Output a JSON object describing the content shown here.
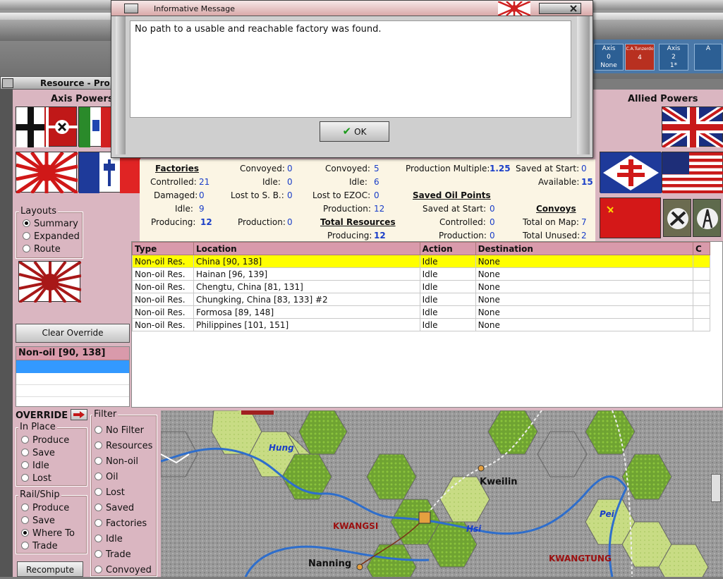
{
  "modal": {
    "title": "Informative Message",
    "message": "No path to a usable and reachable factory was found.",
    "ok_label": "OK"
  },
  "window": {
    "title": "Resource - Pro"
  },
  "counters": [
    {
      "top": "Axis",
      "bottom": "0",
      "sub": "None"
    },
    {
      "top": "C.A.Tunzerdo",
      "bottom": "4",
      "sub": ""
    },
    {
      "top": "Axis",
      "bottom": "2",
      "sub": "1*"
    },
    {
      "top": "A",
      "bottom": "",
      "sub": ""
    }
  ],
  "axis_header": "Axis Powers",
  "allied_header": "Allied Powers",
  "layouts": {
    "label": "Layouts",
    "options": [
      "Summary",
      "Expanded",
      "Route"
    ],
    "selected": "Summary"
  },
  "clear_override_label": "Clear Override",
  "selected_list": {
    "header": "Non-oil [90, 138]"
  },
  "stats": {
    "factories_header": "Factories",
    "controlled_label": "Controlled:",
    "controlled_val": "21",
    "damaged_label": "Damaged:",
    "damaged_val": "0",
    "idle_label": "Idle:",
    "idle_val": "9",
    "producing_label": "Producing:",
    "producing_val": "12",
    "c2_convoyed_label": "Convoyed:",
    "c2_convoyed_val": "0",
    "c2_idle_label": "Idle:",
    "c2_idle_val": "0",
    "c2_lost_label": "Lost to S. B.:",
    "c2_lost_val": "0",
    "c2_production_label": "Production:",
    "c2_production_val": "0",
    "c3_convoyed_label": "Convoyed:",
    "c3_convoyed_val": "5",
    "c3_idle_label": "Idle:",
    "c3_idle_val": "6",
    "c3_lost_label": "Lost to EZOC:",
    "c3_lost_val": "0",
    "c3_production_label": "Production:",
    "c3_production_val": "12",
    "total_resources_header": "Total Resources",
    "c3_producing_label": "Producing:",
    "c3_producing_val": "12",
    "prod_mult_label": "Production Multiple:",
    "prod_mult_val": "1.25",
    "saved_oil_header": "Saved Oil Points",
    "oil_saved_label": "Saved at Start:",
    "oil_saved_val": "0",
    "oil_controlled_label": "Controlled:",
    "oil_controlled_val": "0",
    "oil_production_label": "Production:",
    "oil_production_val": "0",
    "c5_saved_label": "Saved at Start:",
    "c5_saved_val": "0",
    "c5_available_label": "Available:",
    "c5_available_val": "15",
    "convoys_header": "Convoys",
    "conv_total_map_label": "Total on Map:",
    "conv_total_map_val": "7",
    "conv_total_unused_label": "Total Unused:",
    "conv_total_unused_val": "2"
  },
  "grid": {
    "columns": [
      "Type",
      "Location",
      "Action",
      "Destination",
      "C"
    ],
    "rows": [
      [
        "Non-oil Res.",
        "China [90, 138]",
        "Idle",
        "None",
        ""
      ],
      [
        "Non-oil Res.",
        "Hainan [96, 139]",
        "Idle",
        "None",
        ""
      ],
      [
        "Non-oil Res.",
        "Chengtu, China [81, 131]",
        "Idle",
        "None",
        ""
      ],
      [
        "Non-oil Res.",
        "Chungking, China [83, 133] #2",
        "Idle",
        "None",
        ""
      ],
      [
        "Non-oil Res.",
        "Formosa [89, 148]",
        "Idle",
        "None",
        ""
      ],
      [
        "Non-oil Res.",
        "Philippines [101, 151]",
        "Idle",
        "None",
        ""
      ]
    ]
  },
  "override": {
    "label": "OVERRIDE",
    "in_place": {
      "label": "In Place",
      "options": [
        "Produce",
        "Save",
        "Idle",
        "Lost"
      ]
    },
    "rail_ship": {
      "label": "Rail/Ship",
      "options": [
        "Produce",
        "Save",
        "Where To",
        "Trade"
      ],
      "selected": "Where To"
    },
    "recompute_label": "Recompute"
  },
  "filter": {
    "label": "Filter",
    "options": [
      "No Filter",
      "Resources",
      "Non-oil",
      "Oil",
      "Lost",
      "Saved",
      "Factories",
      "Idle",
      "Trade",
      "Convoyed"
    ]
  },
  "map_labels": {
    "hung": "Hung",
    "kweilin": "Kweilin",
    "kwangsi": "KWANGSI",
    "hsi": "Hsi",
    "pei": "Pei",
    "nanning": "Nanning",
    "kwangtung": "KWANGTUNG"
  },
  "colors": {
    "panel_pink": "#dab6c1",
    "header_pink": "#d99aab",
    "selected_row": "#ffff00",
    "value_blue": "#1a3ec8",
    "region_red": "#9b1010",
    "river_blue": "#1a3ec8"
  }
}
